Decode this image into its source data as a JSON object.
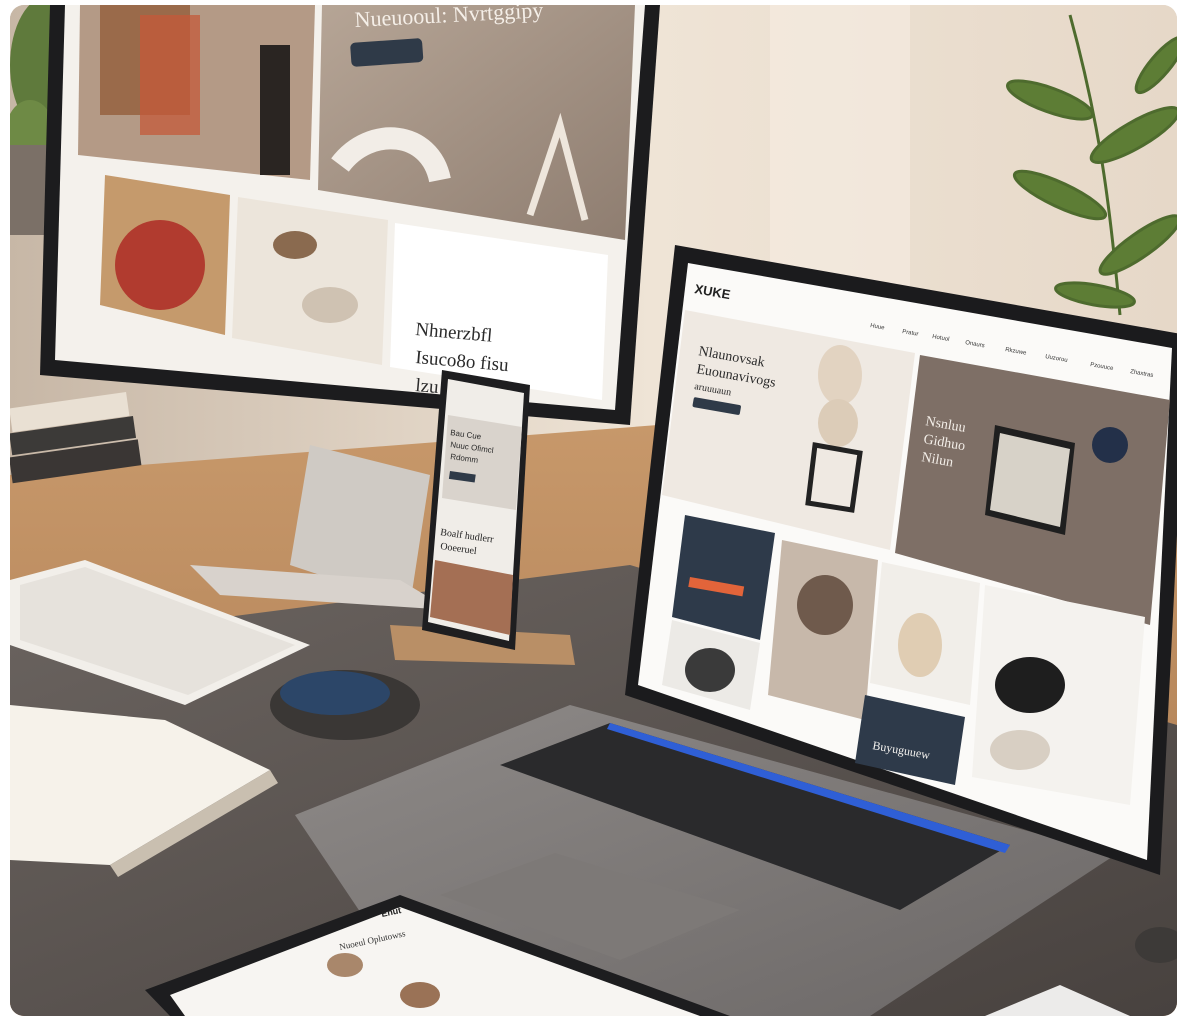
{
  "scene": {
    "desktop_monitor": {
      "hero_text": "Nueuooul: Nvrtggipy",
      "hero_button": "",
      "side_text_lines": [
        "Nhnerzbfl",
        "Isuco8o fisu",
        "lzu"
      ]
    },
    "phone": {
      "hero_lines": [
        "Bau Cue",
        "Nuuc Ofimcl",
        "Rdomm"
      ],
      "caption_lines": [
        "Boalf hudlerr",
        "Ooeeruel"
      ]
    },
    "laptop": {
      "logo": "XUKE",
      "nav_items": [
        "Huue",
        "Pratur",
        "Hotuol",
        "Onaurs",
        "Rkzuwe",
        "Uuzorou",
        "Pzouuce",
        "Zhaxtras"
      ],
      "hero_lines": [
        "Nlaunovsak",
        "Euounavivogs",
        "aruuuaun"
      ],
      "panel_lines": [
        "Nsnluu",
        "Gidhuo",
        "Nilun"
      ],
      "dark_tile_label": "Buyuguuew"
    },
    "tablet": {
      "heading": "Nuoeul Oplutowss",
      "logo": "Enut"
    },
    "colors": {
      "wall": "#e9ddd0",
      "desk": "#b98a5f",
      "mat": "#5a5450",
      "dark_tile": "#2e3a4a",
      "accent_orange": "#e2643a",
      "laptop_backlight": "#2f5fd6"
    }
  }
}
